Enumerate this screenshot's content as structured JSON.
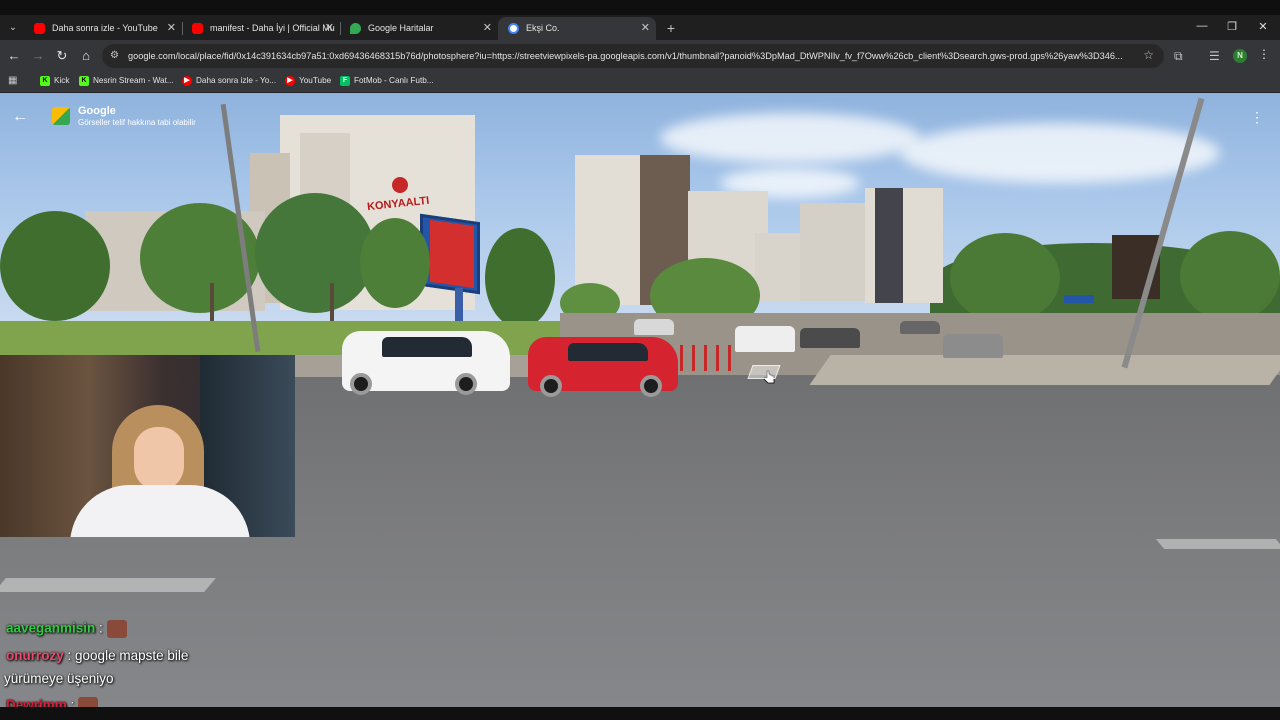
{
  "browser": {
    "tabs": [
      {
        "title": "Daha sonra izle - YouTube",
        "icon": "youtube-icon",
        "active": false
      },
      {
        "title": "manifest - Daha İyi | Official Mu",
        "icon": "youtube-icon",
        "active": false
      },
      {
        "title": "Google Haritalar",
        "icon": "google-maps-icon",
        "active": false
      },
      {
        "title": "Ekşi Co.",
        "icon": "google-icon",
        "active": true
      }
    ],
    "address_bar": {
      "url": "google.com/local/place/fid/0x14c391634cb97a51:0xd69436468315b76d/photosphere?iu=https://streetviewpixels-pa.googleapis.com/v1/thumbnail?panoid%3DpMad_DtWPNIlv_fv_f7Oww%26cb_client%3Dsearch.gws-prod.gps%26yaw%3D346..."
    },
    "profile_initial": "N",
    "bookmarks": [
      {
        "label": "Kick",
        "icon": "kick-icon",
        "color": "#53fc18"
      },
      {
        "label": "Nesrin Stream - Wat...",
        "icon": "kick-icon",
        "color": "#53fc18"
      },
      {
        "label": "Daha sonra izle - Yo...",
        "icon": "youtube-icon",
        "color": "#ff0000"
      },
      {
        "label": "YouTube",
        "icon": "youtube-icon",
        "color": "#ff0000"
      },
      {
        "label": "FotMob - Canlı Futb...",
        "icon": "fotmob-icon",
        "color": "#00c060"
      }
    ]
  },
  "street_view": {
    "brand": "Google",
    "copyright": "Görseller telif hakkına tabi olabilir",
    "building_sign": "KONYAALTI"
  },
  "chat": [
    {
      "user": "aaveganmisin",
      "message": "",
      "emote": true,
      "color": "#2ecc40"
    },
    {
      "user": "onurrozy",
      "message": "google mapste bile",
      "emote": false,
      "color": "#e84a6a"
    },
    {
      "user": "",
      "message": "yürümeye üşeniyo",
      "emote": false,
      "color": "#ffffff"
    },
    {
      "user": "Dewrimm",
      "message": "",
      "emote": true,
      "color": "#d0203b"
    }
  ]
}
